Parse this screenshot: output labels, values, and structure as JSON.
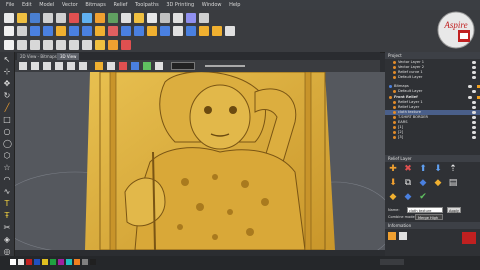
{
  "menu": [
    "File",
    "Edit",
    "Model",
    "Vector",
    "Bitmaps",
    "Relief",
    "Toolpaths",
    "3D Printing",
    "Window",
    "Help"
  ],
  "tabs": [
    "2D View - Bitmaps Layer",
    "3D View"
  ],
  "project": {
    "title": "Project",
    "items": [
      {
        "label": "Vector Layer 1"
      },
      {
        "label": "Vector Layer 2"
      },
      {
        "label": "Relief curve 1"
      },
      {
        "label": "Default Layer"
      },
      {
        "label": "Bitmaps"
      },
      {
        "label": "Default Layer"
      },
      {
        "label": "Front Relief"
      },
      {
        "label": "Relief Layer 1"
      },
      {
        "label": "Relief Layer"
      },
      {
        "label": "cloth texture"
      },
      {
        "label": "T-SHIRT BORDER"
      },
      {
        "label": "EARS"
      },
      {
        "label": "[1]"
      },
      {
        "label": "[2]"
      },
      {
        "label": "[3]"
      }
    ]
  },
  "layer_panel": {
    "title": "Relief Layer"
  },
  "name_field": {
    "label": "Name:",
    "value": "cloth texture",
    "apply": "Apply"
  },
  "combine": {
    "label": "Combine mode:",
    "value": "Merge High"
  },
  "info_title": "Information",
  "logo_text": "Aspire",
  "colors": {
    "relief": "#d4a73a",
    "accent": "#e08a2a",
    "selection": "#4a5f8a"
  }
}
